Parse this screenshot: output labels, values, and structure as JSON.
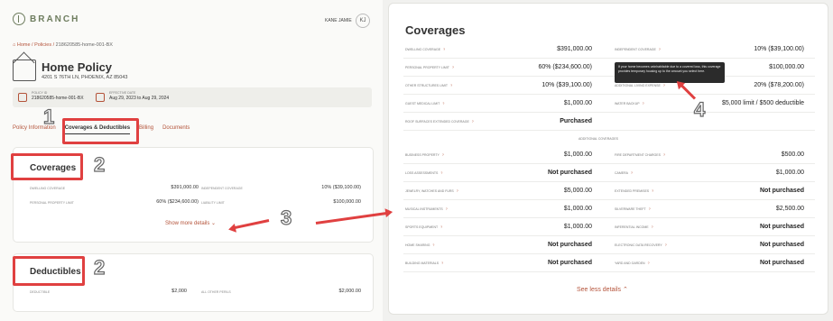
{
  "brand": {
    "name": "BRANCH"
  },
  "user": {
    "name": "KANE JAMIE",
    "initials": "KJ"
  },
  "breadcrumb": {
    "home": "Home",
    "policies": "Policies",
    "current": "218620585-home-001-BX"
  },
  "policy": {
    "title": "Home Policy",
    "address": "4201 S 76TH LN, PHOENIX, AZ 85043",
    "policy_id_label": "POLICY ID",
    "policy_id": "218620585-home-001-BX",
    "effective_label": "EFFECTIVE DATE",
    "effective_dates": "Aug 29, 2023 to Aug 29, 2024"
  },
  "tabs": [
    "Policy Information",
    "Coverages & Deductibles",
    "Billing",
    "Documents"
  ],
  "coverages_card": {
    "title": "Coverages",
    "rows": [
      {
        "label": "DWELLING COVERAGE",
        "value": "$391,000.00"
      },
      {
        "label": "INDEPENDENT COVERAGE",
        "value": "10% ($39,100.00)"
      },
      {
        "label": "PERSONAL PROPERTY LIMIT",
        "value": "60% ($234,600.00)"
      },
      {
        "label": "LIABILITY LIMIT",
        "value": "$100,000.00"
      }
    ],
    "show_more": "Show more details"
  },
  "deductibles_card": {
    "title": "Deductibles",
    "rows": [
      {
        "label": "DEDUCTIBLE",
        "value": "$2,000"
      },
      {
        "label": "ALL OTHER PERILS",
        "value": "$2,000.00"
      }
    ]
  },
  "annotations": [
    "1",
    "2",
    "3",
    "2",
    "4"
  ],
  "right": {
    "title": "Coverages",
    "rows": [
      {
        "left_label": "DWELLING COVERAGE",
        "left_value": "$391,000.00",
        "right_label": "INDEPENDENT COVERAGE",
        "right_value": "10% ($39,100.00)"
      },
      {
        "left_label": "PERSONAL PROPERTY LIMIT",
        "left_value": "60% ($234,600.00)",
        "right_label": "",
        "right_value": "$100,000.00"
      },
      {
        "left_label": "OTHER STRUCTURES LIMIT",
        "left_value": "10% ($39,100.00)",
        "right_label": "ADDITIONAL LIVING EXPENSE",
        "right_value": "20% ($78,200.00)"
      },
      {
        "left_label": "GUEST MEDICAL LIMIT",
        "left_value": "$1,000.00",
        "right_label": "WATER BACKUP",
        "right_value": "$5,000 limit / $500 deductible"
      },
      {
        "left_label": "ROOF SURFACES EXTENDED COVERAGE",
        "left_value": "Purchased",
        "right_label": "",
        "right_value": ""
      }
    ],
    "tooltip": "If your home becomes uninhabitable due to a covered loss, this coverage provides temporary housing up to the amount you select here.",
    "additional_label": "ADDITIONAL COVERAGES",
    "additional": [
      {
        "left_label": "BUSINESS PROPERTY",
        "left_value": "$1,000.00",
        "right_label": "FIRE DEPARTMENT CHARGES",
        "right_value": "$500.00"
      },
      {
        "left_label": "LOSS ASSESSMENTS",
        "left_value": "Not purchased",
        "right_label": "CAMERA",
        "right_value": "$1,000.00"
      },
      {
        "left_label": "JEWELRY, WATCHES AND FURS",
        "left_value": "$5,000.00",
        "right_label": "EXTENDED PREMISES",
        "right_value": "Not purchased"
      },
      {
        "left_label": "MUSICAL INSTRUMENTS",
        "left_value": "$1,000.00",
        "right_label": "SILVERWARE THEFT",
        "right_value": "$2,500.00"
      },
      {
        "left_label": "SPORTS EQUIPMENT",
        "left_value": "$1,000.00",
        "right_label": "INFERENTIAL INCOME",
        "right_value": "Not purchased"
      },
      {
        "left_label": "HOME SHARING",
        "left_value": "Not purchased",
        "right_label": "ELECTRONIC DATA RECOVERY",
        "right_value": "Not purchased"
      },
      {
        "left_label": "BUILDING MATERIALS",
        "left_value": "Not purchased",
        "right_label": "YARD AND GARDEN",
        "right_value": "Not purchased"
      }
    ],
    "see_less": "See less details"
  },
  "colors": {
    "accent": "#b4533a",
    "annotation": "#e04040",
    "brand": "#6e7d5f"
  }
}
